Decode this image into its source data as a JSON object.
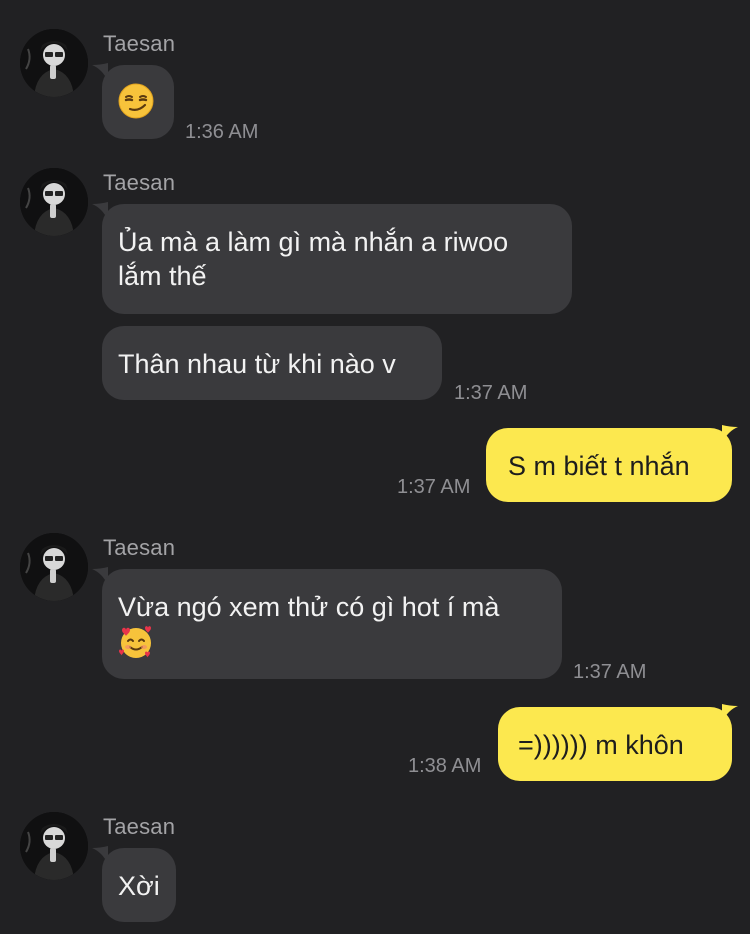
{
  "conversation": {
    "sender_name": "Taesan",
    "groups": [
      {
        "sender": "Taesan",
        "messages": [
          {
            "icon": "smirking-face-emoji",
            "text": ""
          }
        ],
        "time": "1:36 AM"
      },
      {
        "sender": "Taesan",
        "messages": [
          {
            "text": "Ủa mà a làm gì mà nhắn a riwoo lắm thế"
          },
          {
            "text": "Thân nhau từ khi nào v"
          }
        ],
        "time": "1:37 AM"
      },
      {
        "sender": "me",
        "messages": [
          {
            "text": "S m biết t nhắn"
          }
        ],
        "time": "1:37 AM"
      },
      {
        "sender": "Taesan",
        "messages": [
          {
            "text": "Vừa ngó xem thử có gì hot í mà",
            "icon": "smiling-face-with-hearts-emoji"
          }
        ],
        "time": "1:37 AM"
      },
      {
        "sender": "me",
        "messages": [
          {
            "text": "=)))))) m khôn"
          }
        ],
        "time": "1:38 AM"
      },
      {
        "sender": "Taesan",
        "messages": [
          {
            "text": "Xời"
          }
        ],
        "time": ""
      }
    ]
  },
  "colors": {
    "background": "#212123",
    "incoming_bubble": "#3a3a3d",
    "outgoing_bubble": "#fce84f",
    "incoming_text": "#f2f2f2",
    "outgoing_text": "#1d1d1d",
    "meta_text": "#8f8f93"
  }
}
